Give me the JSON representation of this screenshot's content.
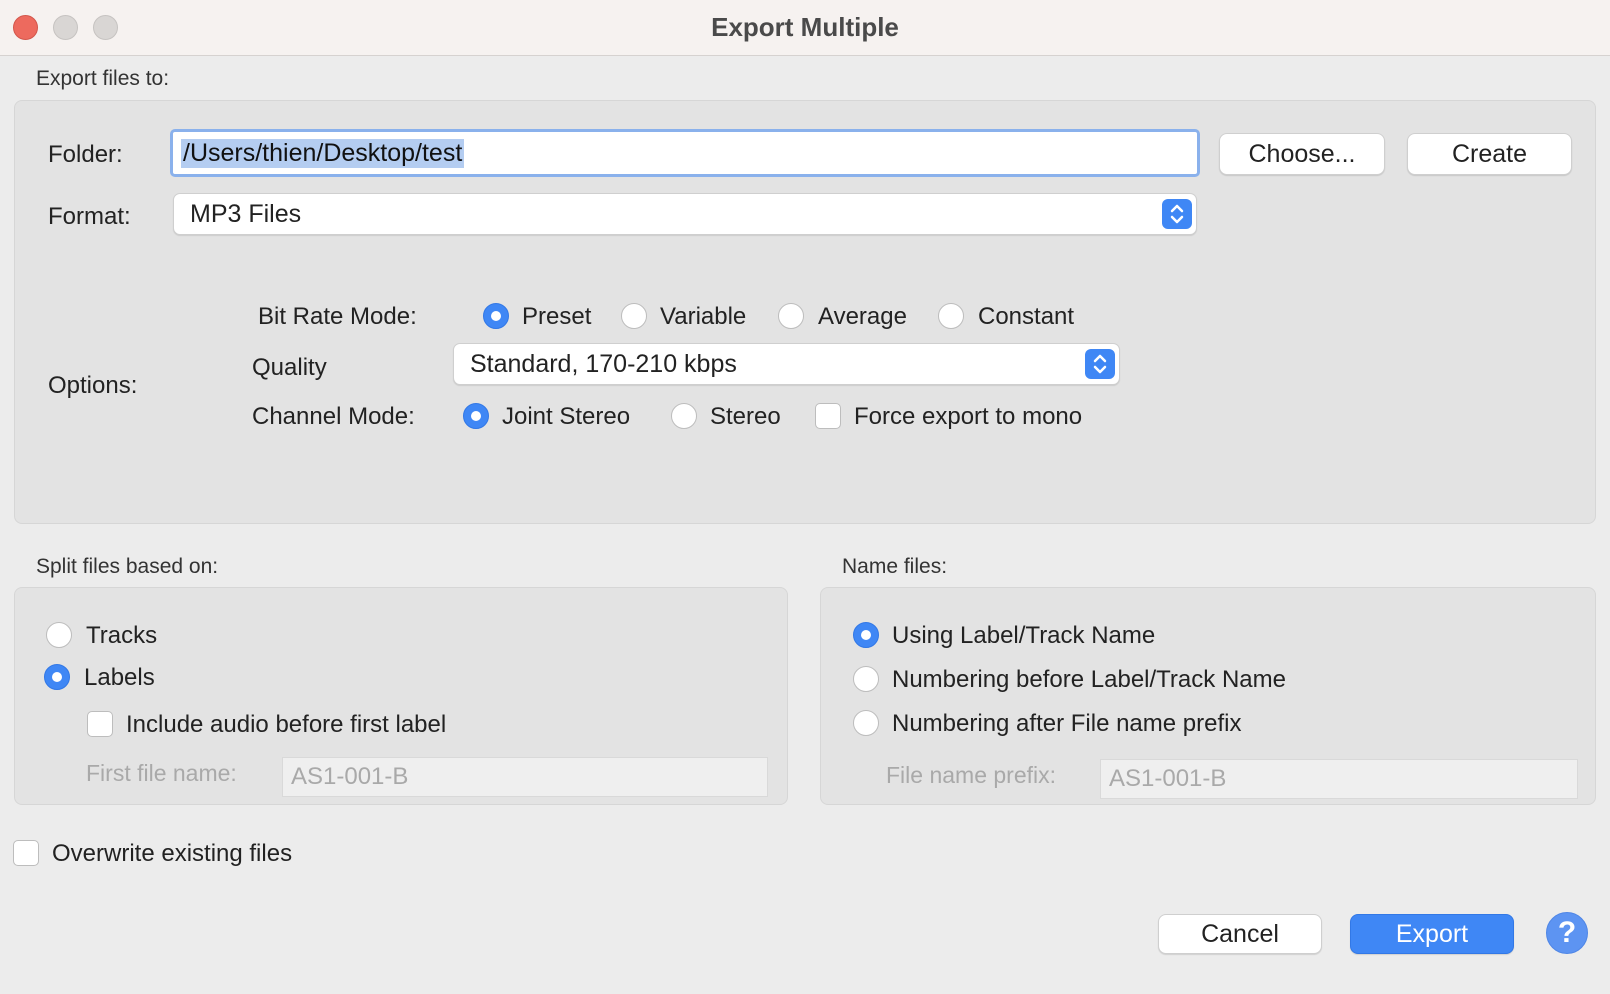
{
  "window": {
    "title": "Export Multiple"
  },
  "export_to": {
    "section_label": "Export files to:",
    "folder_label": "Folder:",
    "folder_value": "/Users/thien/Desktop/test",
    "choose_label": "Choose...",
    "create_label": "Create",
    "format_label": "Format:",
    "format_value": "MP3 Files"
  },
  "options": {
    "label": "Options:",
    "bit_rate_label": "Bit Rate Mode:",
    "bit_rate_options": [
      "Preset",
      "Variable",
      "Average",
      "Constant"
    ],
    "bit_rate_selected": "Preset",
    "quality_label": "Quality",
    "quality_value": "Standard, 170-210 kbps",
    "channel_label": "Channel Mode:",
    "channel_options": [
      "Joint Stereo",
      "Stereo"
    ],
    "channel_selected": "Joint Stereo",
    "force_mono_label": "Force export to mono",
    "force_mono_checked": false
  },
  "split": {
    "section_label": "Split files based on:",
    "tracks_label": "Tracks",
    "labels_label": "Labels",
    "selected": "Labels",
    "include_audio_label": "Include audio before first label",
    "include_audio_checked": false,
    "first_file_label": "First file name:",
    "first_file_value": "AS1-001-B"
  },
  "name_files": {
    "section_label": "Name files:",
    "options": [
      "Using Label/Track Name",
      "Numbering before Label/Track Name",
      "Numbering after File name prefix"
    ],
    "selected": "Using Label/Track Name",
    "prefix_label": "File name prefix:",
    "prefix_value": "AS1-001-B"
  },
  "overwrite": {
    "label": "Overwrite existing files",
    "checked": false
  },
  "footer": {
    "cancel_label": "Cancel",
    "export_label": "Export",
    "help_glyph": "?"
  },
  "colors": {
    "accent": "#3f87f5",
    "focus_ring": "#8ab1ec",
    "close": "#ed6a5e"
  }
}
